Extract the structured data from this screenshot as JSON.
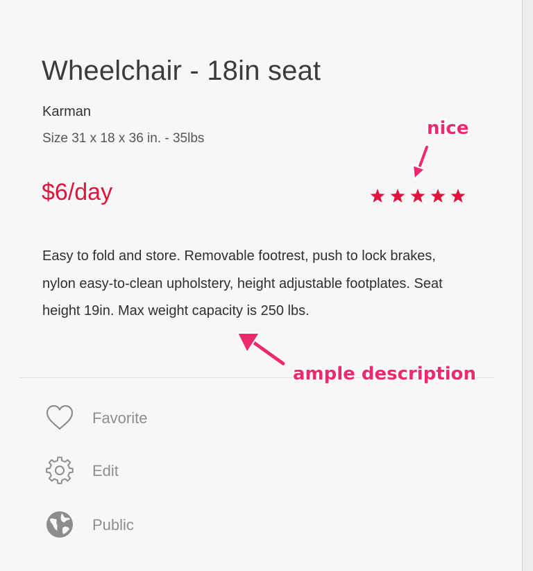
{
  "product": {
    "title": "Wheelchair - 18in seat",
    "brand": "Karman",
    "size": "Size 31 x 18 x 36 in. - 35lbs",
    "price_amount": "$6",
    "price_unit": "/day",
    "rating": 5,
    "rating_max": 5,
    "description": "Easy to fold and store. Removable footrest, push to lock brakes, nylon easy-to-clean upholstery, height adjustable footplates. Seat height 19in. Max weight capacity is 250 lbs."
  },
  "actions": {
    "favorite_label": "Favorite",
    "edit_label": "Edit",
    "public_label": "Public"
  },
  "annotations": {
    "nice": "nice",
    "ample": "ample description"
  },
  "colors": {
    "price": "#e0133c",
    "star": "#e0133c",
    "annotation": "#ee2a6e",
    "action_text": "#8d8d8d",
    "icon": "#8d8d8d"
  },
  "icons": {
    "favorite": "heart-icon",
    "edit": "gear-icon",
    "public": "globe-icon",
    "rating": "star-icon"
  }
}
